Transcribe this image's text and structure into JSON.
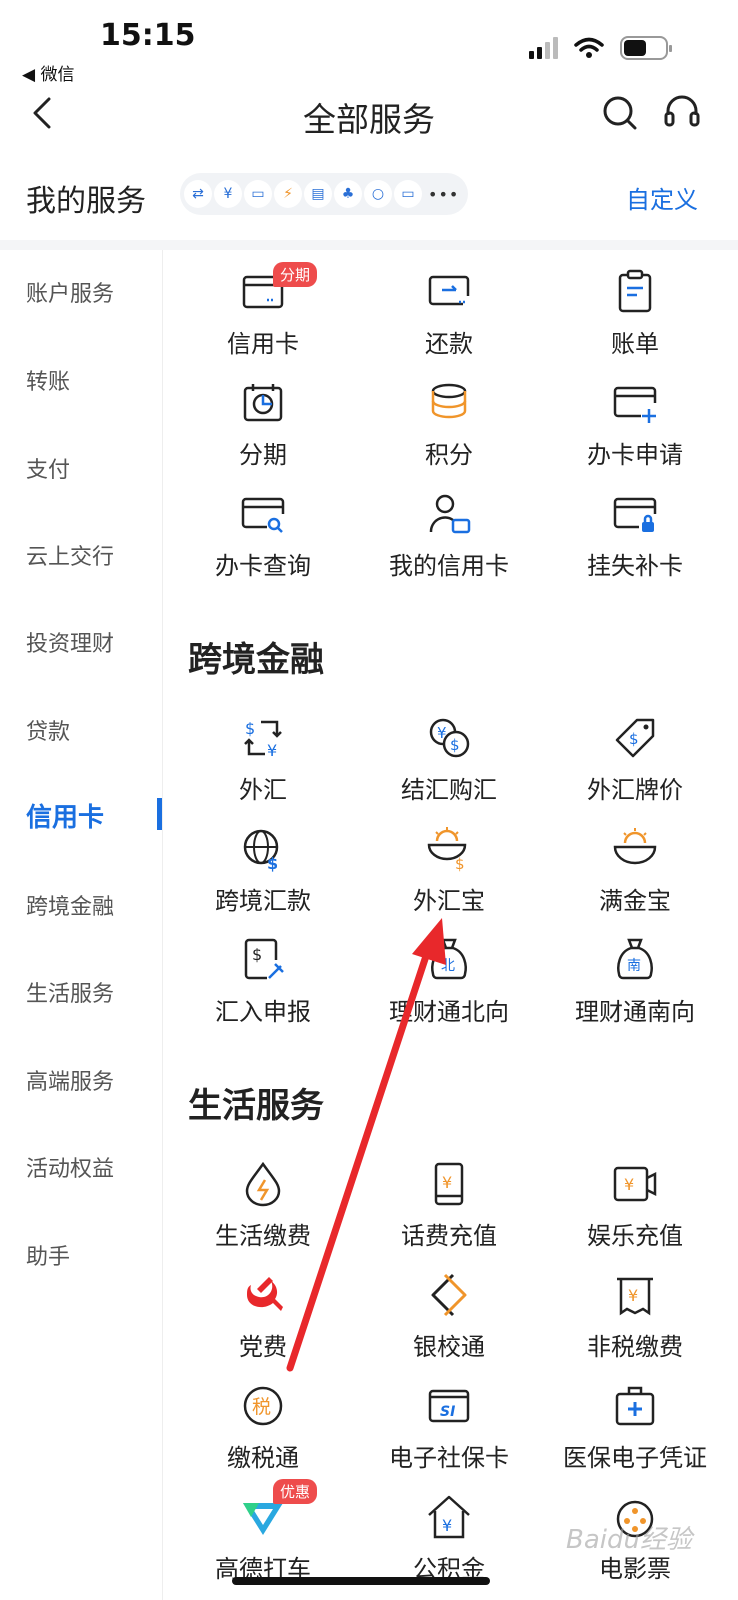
{
  "status_bar": {
    "time": "15:15",
    "back_app": "◀ 微信"
  },
  "navbar": {
    "title": "全部服务"
  },
  "my_services": {
    "title": "我的服务",
    "customize": "自定义",
    "more": "•••"
  },
  "sidebar": {
    "items": [
      {
        "label": "账户服务"
      },
      {
        "label": "转账"
      },
      {
        "label": "支付"
      },
      {
        "label": "云上交行"
      },
      {
        "label": "投资理财"
      },
      {
        "label": "贷款"
      },
      {
        "label": "信用卡"
      },
      {
        "label": "跨境金融"
      },
      {
        "label": "生活服务"
      },
      {
        "label": "高端服务"
      },
      {
        "label": "活动权益"
      },
      {
        "label": "助手"
      }
    ],
    "active_index": 6
  },
  "credit_card": {
    "items": [
      {
        "label": "信用卡",
        "icon": "credit-card-icon",
        "badge": "分期"
      },
      {
        "label": "还款",
        "icon": "repay-icon"
      },
      {
        "label": "账单",
        "icon": "bill-icon"
      },
      {
        "label": "分期",
        "icon": "installment-icon"
      },
      {
        "label": "积分",
        "icon": "points-icon"
      },
      {
        "label": "办卡申请",
        "icon": "card-apply-icon"
      },
      {
        "label": "办卡查询",
        "icon": "card-query-icon"
      },
      {
        "label": "我的信用卡",
        "icon": "my-card-icon"
      },
      {
        "label": "挂失补卡",
        "icon": "card-lock-icon"
      }
    ]
  },
  "cross_border": {
    "title": "跨境金融",
    "items": [
      {
        "label": "外汇",
        "icon": "forex-icon"
      },
      {
        "label": "结汇购汇",
        "icon": "exchange-icon"
      },
      {
        "label": "外汇牌价",
        "icon": "price-tag-icon"
      },
      {
        "label": "跨境汇款",
        "icon": "globe-icon"
      },
      {
        "label": "外汇宝",
        "icon": "forex-bowl-icon"
      },
      {
        "label": "满金宝",
        "icon": "gold-bowl-icon"
      },
      {
        "label": "汇入申报",
        "icon": "declare-icon"
      },
      {
        "label": "理财通北向",
        "icon": "north-bag-icon",
        "glyph": "北"
      },
      {
        "label": "理财通南向",
        "icon": "south-bag-icon",
        "glyph": "南"
      }
    ]
  },
  "life_services": {
    "title": "生活服务",
    "items": [
      {
        "label": "生活缴费",
        "icon": "utility-icon"
      },
      {
        "label": "话费充值",
        "icon": "phone-topup-icon"
      },
      {
        "label": "娱乐充值",
        "icon": "entertainment-icon"
      },
      {
        "label": "党费",
        "icon": "party-icon"
      },
      {
        "label": "银校通",
        "icon": "school-icon"
      },
      {
        "label": "非税缴费",
        "icon": "non-tax-icon"
      },
      {
        "label": "缴税通",
        "icon": "tax-icon",
        "glyph": "税"
      },
      {
        "label": "电子社保卡",
        "icon": "social-card-icon",
        "glyph": "SI"
      },
      {
        "label": "医保电子凭证",
        "icon": "medical-icon"
      },
      {
        "label": "高德打车",
        "icon": "taxi-icon",
        "badge": "优惠"
      },
      {
        "label": "公积金",
        "icon": "fund-icon"
      },
      {
        "label": "电影票",
        "icon": "movie-icon"
      }
    ]
  },
  "watermark": "Baidu经验",
  "colors": {
    "accent": "#1a6fe0",
    "icon_orange": "#f0952b",
    "badge_red": "#ee4c4c",
    "arrow_red": "#e8282b"
  }
}
